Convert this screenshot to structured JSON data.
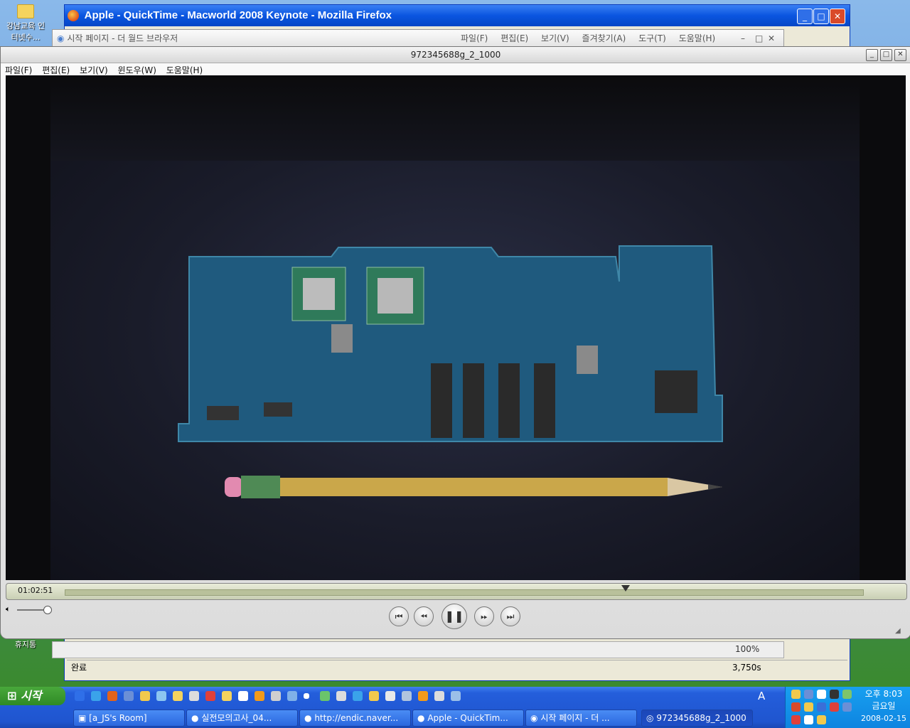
{
  "desktop": {
    "icon1_label": "강남교육 인터넷수...",
    "icon2_label": "휴지통"
  },
  "firefox": {
    "title": "Apple - QuickTime - Macworld 2008 Keynote - Mozilla Firefox",
    "status": "완료",
    "status_size": "3,750s",
    "zoom": "100%"
  },
  "browser": {
    "title": "시작 페이지 - 더 월드 브라우저",
    "menu": [
      "파일(F)",
      "편집(E)",
      "보기(V)",
      "즐겨찾기(A)",
      "도구(T)",
      "도움말(H)"
    ]
  },
  "quicktime": {
    "title": "972345688g_2_1000",
    "menu": [
      "파일(F)",
      "편집(E)",
      "보기(V)",
      "윈도우(W)",
      "도움말(H)"
    ],
    "time": "01:02:51",
    "progress": 0.703
  },
  "taskbar": {
    "start_label": "시작",
    "lang": "A",
    "buttons": [
      {
        "label": "[a_JS's Room]"
      },
      {
        "label": "실전모의고사_04..."
      },
      {
        "label": "http://endic.naver..."
      },
      {
        "label": "Apple - QuickTim..."
      },
      {
        "label": "시작 페이지 - 더 ..."
      },
      {
        "label": "972345688g_2_1000"
      }
    ],
    "clock": {
      "time": "오후 8:03",
      "day": "금요일",
      "date": "2008-02-15"
    }
  },
  "colors": {
    "xp_blue": "#245edb",
    "start_green": "#2f8a25",
    "qt_progress": "#b9c19b"
  }
}
